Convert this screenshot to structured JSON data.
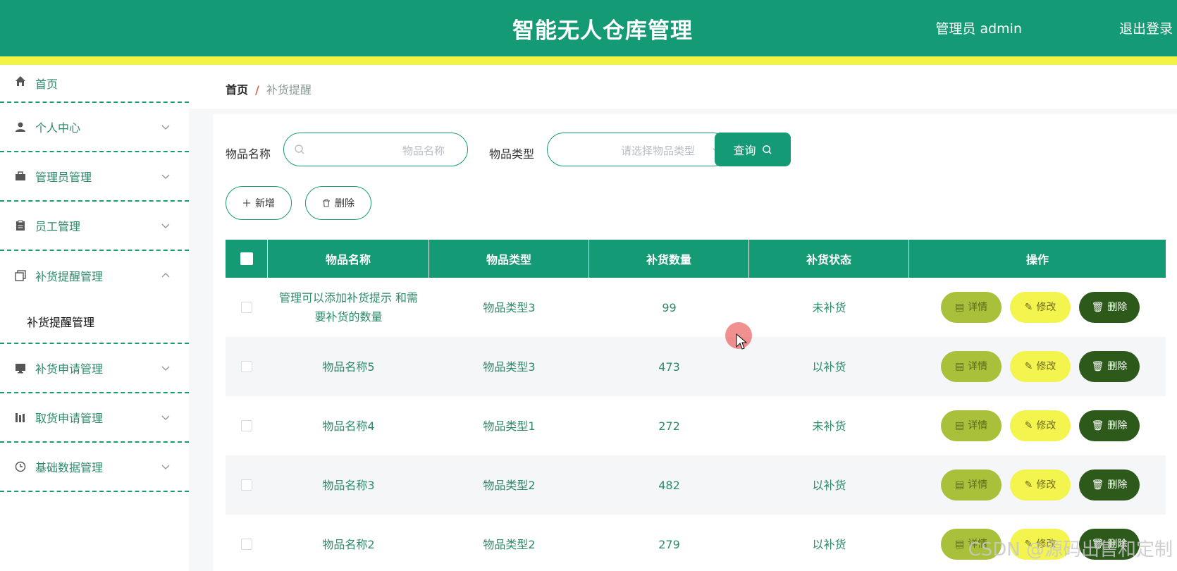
{
  "header": {
    "title": "智能无人仓库管理",
    "user": "管理员 admin",
    "logout": "退出登录"
  },
  "sidebar": {
    "items": [
      {
        "label": "首页",
        "icon": "home-icon"
      },
      {
        "label": "个人中心",
        "icon": "user-icon"
      },
      {
        "label": "管理员管理",
        "icon": "briefcase-icon"
      },
      {
        "label": "员工管理",
        "icon": "clipboard-icon"
      },
      {
        "label": "补货提醒管理",
        "icon": "copy-icon",
        "expanded": true,
        "sub": "补货提醒管理"
      },
      {
        "label": "补货申请管理",
        "icon": "monitor-icon"
      },
      {
        "label": "取货申请管理",
        "icon": "chart-icon"
      },
      {
        "label": "基础数据管理",
        "icon": "clock-icon"
      }
    ]
  },
  "breadcrumb": {
    "home": "首页",
    "separator": "/",
    "current": "补货提醒"
  },
  "search": {
    "name_label": "物品名称",
    "name_placeholder": "物品名称",
    "type_label": "物品类型",
    "type_placeholder": "请选择物品类型",
    "query_label": "查询"
  },
  "actions": {
    "add": "新增",
    "delete": "删除"
  },
  "table": {
    "headers": [
      "物品名称",
      "物品类型",
      "补货数量",
      "补货状态",
      "操作"
    ],
    "rows": [
      {
        "name": "管理可以添加补货提示 和需要补货的数量",
        "type": "物品类型3",
        "qty": "99",
        "status": "未补货"
      },
      {
        "name": "物品名称5",
        "type": "物品类型3",
        "qty": "473",
        "status": "以补货"
      },
      {
        "name": "物品名称4",
        "type": "物品类型1",
        "qty": "272",
        "status": "未补货"
      },
      {
        "name": "物品名称3",
        "type": "物品类型2",
        "qty": "482",
        "status": "以补货"
      },
      {
        "name": "物品名称2",
        "type": "物品类型2",
        "qty": "279",
        "status": "以补货"
      }
    ],
    "row_actions": {
      "detail": "详情",
      "edit": "修改",
      "delete": "删除"
    }
  },
  "colors": {
    "primary": "#149a74",
    "accent_yellow": "#f3f346",
    "detail_btn": "#a8c03a",
    "edit_btn": "#f4f44e",
    "delete_btn": "#2d5a1b"
  },
  "watermark": "CSDN @源码出售和定制"
}
